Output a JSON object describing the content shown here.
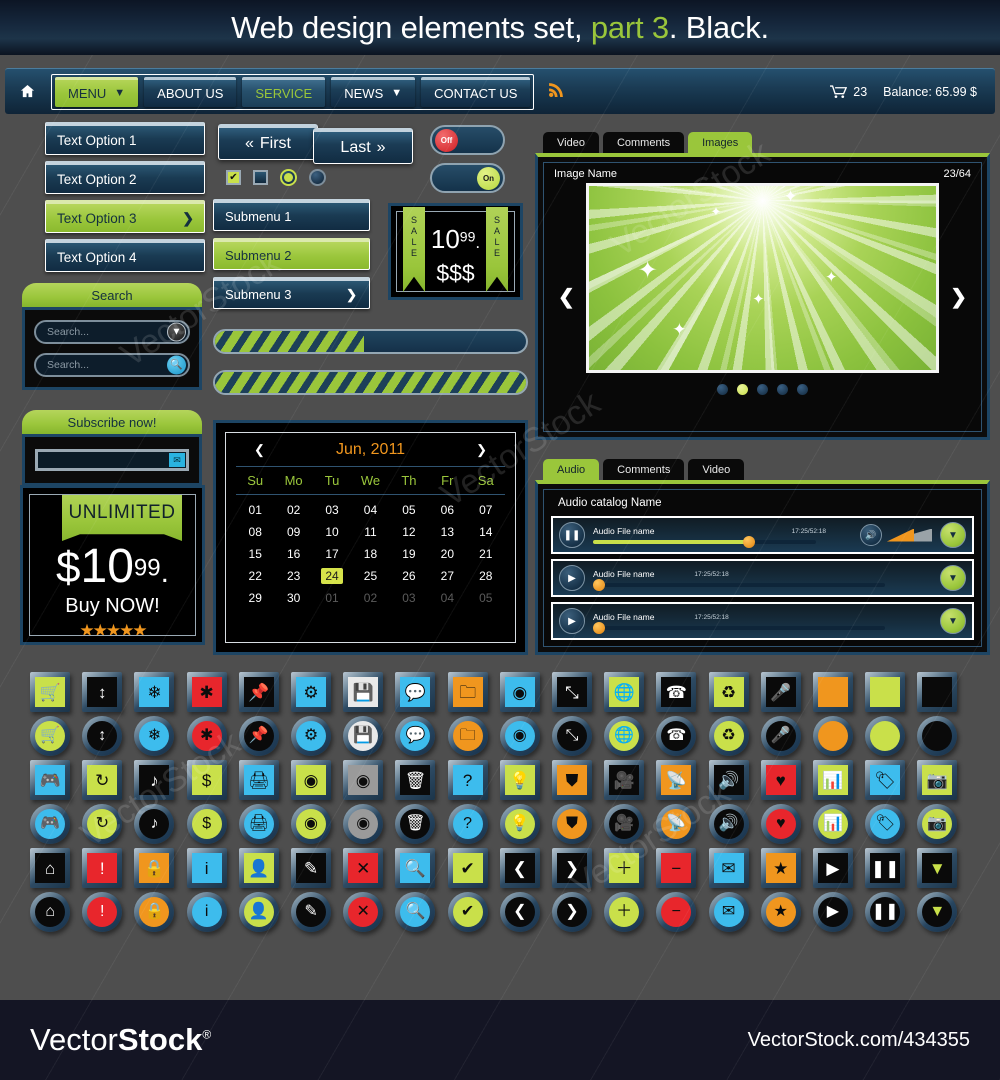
{
  "banner": {
    "title_part1": "Web design elements set, ",
    "title_green": "part 3",
    "title_part2": ". Black."
  },
  "nav": {
    "home_icon": "home-icon",
    "items": [
      {
        "label": "MENU",
        "style": "green",
        "caret": "▼"
      },
      {
        "label": "ABOUT US",
        "style": "dark",
        "caret": ""
      },
      {
        "label": "SERVICE",
        "style": "service",
        "caret": ""
      },
      {
        "label": "NEWS",
        "style": "dark",
        "caret": "▼"
      },
      {
        "label": "CONTACT US",
        "style": "dark",
        "caret": ""
      }
    ],
    "rss_icon": "rss-icon",
    "cart_icon": "cart-icon",
    "cart_count": "23",
    "balance": "Balance: 65.99 $"
  },
  "text_options": [
    {
      "label": "Text Option 1",
      "style": "dark"
    },
    {
      "label": "Text Option 2",
      "style": "dark"
    },
    {
      "label": "Text Option 3",
      "style": "green",
      "arrow": "❯"
    },
    {
      "label": "Text Option 4",
      "style": "dark"
    }
  ],
  "search_widget": {
    "title": "Search",
    "field1_placeholder": "Search...",
    "field1_icon": "chevron-down-icon",
    "field2_placeholder": "Search...",
    "field2_icon": "search-icon"
  },
  "subscribe_widget": {
    "title": "Subscribe now!",
    "value": "",
    "icon": "envelope-icon"
  },
  "price_box": {
    "ribbon": "UNLIMITED",
    "currency": "$",
    "amount": "10",
    "cents": "99",
    "dot": ".",
    "cta": "Buy NOW!",
    "stars": 5,
    "star_color": "#f0961e"
  },
  "pager": {
    "first_label": "First",
    "first_icon": "«",
    "last_label": "Last",
    "last_icon": "»"
  },
  "checkboxes": [
    {
      "name": "checkbox-checked",
      "checked": true,
      "shape": "square"
    },
    {
      "name": "checkbox-unchecked",
      "checked": false,
      "shape": "square"
    },
    {
      "name": "radio-checked",
      "checked": true,
      "shape": "circle"
    },
    {
      "name": "radio-unchecked",
      "checked": false,
      "shape": "circle"
    }
  ],
  "toggles": [
    {
      "label": "Off",
      "state": "off",
      "color": "#e0262a"
    },
    {
      "label": "On",
      "state": "on",
      "color": "#c9e04a"
    }
  ],
  "submenus": [
    {
      "label": "Submenu 1",
      "style": "dark"
    },
    {
      "label": "Submenu 2",
      "style": "green"
    },
    {
      "label": "Submenu 3",
      "style": "dark",
      "arrow": "❯"
    }
  ],
  "sale_tag": {
    "left_ribbon": "SALE",
    "right_ribbon": "SALE",
    "amount": "10",
    "cents": "99",
    "dot": ".",
    "dollars": "$$$"
  },
  "progress_bars": [
    {
      "name": "progress-bar-partial",
      "percent": 48
    },
    {
      "name": "progress-bar-full",
      "percent": 100
    }
  ],
  "calendar": {
    "prev_icon": "❮",
    "next_icon": "❯",
    "month_label": "Jun, 2011",
    "dow": [
      "Su",
      "Mo",
      "Tu",
      "We",
      "Th",
      "Fr",
      "Sa"
    ],
    "weeks": [
      [
        {
          "d": "01"
        },
        {
          "d": "02"
        },
        {
          "d": "03"
        },
        {
          "d": "04"
        },
        {
          "d": "05"
        },
        {
          "d": "06"
        },
        {
          "d": "07"
        }
      ],
      [
        {
          "d": "08"
        },
        {
          "d": "09"
        },
        {
          "d": "10"
        },
        {
          "d": "11"
        },
        {
          "d": "12"
        },
        {
          "d": "13"
        },
        {
          "d": "14"
        }
      ],
      [
        {
          "d": "15"
        },
        {
          "d": "16"
        },
        {
          "d": "17"
        },
        {
          "d": "18"
        },
        {
          "d": "19"
        },
        {
          "d": "20"
        },
        {
          "d": "21"
        }
      ],
      [
        {
          "d": "22"
        },
        {
          "d": "23"
        },
        {
          "d": "24",
          "sel": true
        },
        {
          "d": "25"
        },
        {
          "d": "26"
        },
        {
          "d": "27"
        },
        {
          "d": "28"
        }
      ],
      [
        {
          "d": "29"
        },
        {
          "d": "30"
        },
        {
          "d": "01",
          "mut": true
        },
        {
          "d": "02",
          "mut": true
        },
        {
          "d": "03",
          "mut": true
        },
        {
          "d": "04",
          "mut": true
        },
        {
          "d": "05",
          "mut": true
        }
      ]
    ],
    "selected_day": "24"
  },
  "gallery": {
    "tabs": [
      {
        "label": "Video",
        "active": false
      },
      {
        "label": "Comments",
        "active": false
      },
      {
        "label": "Images",
        "active": true
      }
    ],
    "image_name": "Image Name",
    "counter": "23/64",
    "prev_icon": "❮",
    "next_icon": "❯",
    "dots": 5,
    "active_dot": 2
  },
  "audio": {
    "tabs": [
      {
        "label": "Audio",
        "active": true
      },
      {
        "label": "Comments",
        "active": false
      },
      {
        "label": "Video",
        "active": false
      }
    ],
    "catalog_title": "Audio catalog Name",
    "rows": [
      {
        "play_icon": "pause-icon",
        "name": "Audio File name",
        "time": "17:25/52:18",
        "progress": 70,
        "volume_icon": "speaker-icon",
        "volume": 60,
        "expand_icon": "chevron-down-icon",
        "expand_state": "active"
      },
      {
        "play_icon": "play-icon",
        "name": "Audio File name",
        "time": "17:25/52:18",
        "progress": 3,
        "volume_icon": "",
        "volume": 0,
        "expand_icon": "chevron-down-icon",
        "expand_state": "active"
      },
      {
        "play_icon": "play-icon",
        "name": "Audio File name",
        "time": "17:25/52:18",
        "progress": 3,
        "volume_icon": "",
        "volume": 0,
        "expand_icon": "chevron-down-icon",
        "expand_state": "active"
      }
    ]
  },
  "icon_grid": {
    "rows": [
      [
        {
          "name": "cart-icon",
          "glyph": "🛒",
          "bg": "#c9e04a",
          "fg": "#111111"
        },
        {
          "name": "sliders-icon",
          "glyph": "↕",
          "bg": "#0a0a0a",
          "fg": "#ffffff"
        },
        {
          "name": "snowflake-icon",
          "glyph": "❄",
          "bg": "#3dbced",
          "fg": "#0d0d0d"
        },
        {
          "name": "asterisk-icon",
          "glyph": "✱",
          "bg": "#e8262c",
          "fg": "#0d0d0d"
        },
        {
          "name": "pin-icon",
          "glyph": "📌",
          "bg": "#0a0a0a",
          "fg": "#ffffff"
        },
        {
          "name": "gear-icon",
          "glyph": "⚙",
          "bg": "#3dbced",
          "fg": "#0d0d0d"
        },
        {
          "name": "save-icon",
          "glyph": "💾",
          "bg": "#e9e9e9",
          "fg": "#111111"
        },
        {
          "name": "chat-icon",
          "glyph": "💬",
          "bg": "#3dbced",
          "fg": "#0d0d0d"
        },
        {
          "name": "folder-icon",
          "glyph": "🗀",
          "bg": "#f0961e",
          "fg": "#0d0d0d"
        },
        {
          "name": "disc-icon",
          "glyph": "◉",
          "bg": "#3dbced",
          "fg": "#0d0d0d"
        },
        {
          "name": "expand-icon",
          "glyph": "⤡",
          "bg": "#0a0a0a",
          "fg": "#ffffff"
        },
        {
          "name": "globe-icon",
          "glyph": "🌐",
          "bg": "#c9e04a",
          "fg": "#0d0d0d"
        },
        {
          "name": "phone-icon",
          "glyph": "☎",
          "bg": "#0a0a0a",
          "fg": "#ffffff"
        },
        {
          "name": "recycle-icon",
          "glyph": "♻",
          "bg": "#c9e04a",
          "fg": "#0d0d0d"
        },
        {
          "name": "microphone-icon",
          "glyph": "🎤",
          "bg": "#0a0a0a",
          "fg": "#ffffff"
        },
        {
          "name": "blank-orange-icon",
          "glyph": "",
          "bg": "#f0961e",
          "fg": "#0d0d0d"
        },
        {
          "name": "blank-green-icon",
          "glyph": "",
          "bg": "#c9e04a",
          "fg": "#0d0d0d"
        },
        {
          "name": "blank-black-icon",
          "glyph": "",
          "bg": "#0a0a0a",
          "fg": "#ffffff"
        }
      ],
      [
        {
          "name": "game-controller-icon",
          "glyph": "🎮",
          "bg": "#3dbced",
          "fg": "#0d0d0d"
        },
        {
          "name": "refresh-icon",
          "glyph": "↻",
          "bg": "#c9e04a",
          "fg": "#0d0d0d"
        },
        {
          "name": "music-note-icon",
          "glyph": "♪",
          "bg": "#0a0a0a",
          "fg": "#ffffff"
        },
        {
          "name": "dollar-icon",
          "glyph": "$",
          "bg": "#c9e04a",
          "fg": "#0d0d0d"
        },
        {
          "name": "printer-icon",
          "glyph": "🖨",
          "bg": "#3dbced",
          "fg": "#0d0d0d"
        },
        {
          "name": "eye-icon",
          "glyph": "◉",
          "bg": "#c9e04a",
          "fg": "#0d0d0d"
        },
        {
          "name": "eye-gray-icon",
          "glyph": "◉",
          "bg": "#9a9a9a",
          "fg": "#0d0d0d"
        },
        {
          "name": "trash-icon",
          "glyph": "🗑",
          "bg": "#0a0a0a",
          "fg": "#ffffff"
        },
        {
          "name": "help-icon",
          "glyph": "?",
          "bg": "#3dbced",
          "fg": "#0d0d0d"
        },
        {
          "name": "lightbulb-icon",
          "glyph": "💡",
          "bg": "#c9e04a",
          "fg": "#0d0d0d"
        },
        {
          "name": "shield-icon",
          "glyph": "⛊",
          "bg": "#f0961e",
          "fg": "#0d0d0d"
        },
        {
          "name": "video-camera-icon",
          "glyph": "🎥",
          "bg": "#0a0a0a",
          "fg": "#ffffff"
        },
        {
          "name": "rss-icon",
          "glyph": "📡",
          "bg": "#f0961e",
          "fg": "#0d0d0d"
        },
        {
          "name": "speaker-icon",
          "glyph": "🔊",
          "bg": "#0a0a0a",
          "fg": "#ffffff"
        },
        {
          "name": "heart-icon",
          "glyph": "♥",
          "bg": "#e8262c",
          "fg": "#0d0d0d"
        },
        {
          "name": "chart-icon",
          "glyph": "📊",
          "bg": "#c9e04a",
          "fg": "#0d0d0d"
        },
        {
          "name": "tag-icon",
          "glyph": "🏷",
          "bg": "#3dbced",
          "fg": "#0d0d0d"
        },
        {
          "name": "camera-icon",
          "glyph": "📷",
          "bg": "#c9e04a",
          "fg": "#0d0d0d"
        }
      ],
      [
        {
          "name": "home-icon",
          "glyph": "⌂",
          "bg": "#0a0a0a",
          "fg": "#ffffff"
        },
        {
          "name": "warning-icon",
          "glyph": "!",
          "bg": "#e8262c",
          "fg": "#ffffff"
        },
        {
          "name": "lock-icon",
          "glyph": "🔒",
          "bg": "#f0961e",
          "fg": "#0d0d0d"
        },
        {
          "name": "info-icon",
          "glyph": "i",
          "bg": "#3dbced",
          "fg": "#0d0d0d"
        },
        {
          "name": "user-icon",
          "glyph": "👤",
          "bg": "#c9e04a",
          "fg": "#0d0d0d"
        },
        {
          "name": "pencil-icon",
          "glyph": "✎",
          "bg": "#0a0a0a",
          "fg": "#ffffff"
        },
        {
          "name": "close-icon",
          "glyph": "✕",
          "bg": "#e8262c",
          "fg": "#0d0d0d"
        },
        {
          "name": "search-icon",
          "glyph": "🔍",
          "bg": "#3dbced",
          "fg": "#0d0d0d"
        },
        {
          "name": "check-icon",
          "glyph": "✔",
          "bg": "#c9e04a",
          "fg": "#0d0d0d"
        },
        {
          "name": "chevron-left-icon",
          "glyph": "❮",
          "bg": "#0a0a0a",
          "fg": "#ffffff"
        },
        {
          "name": "chevron-right-icon",
          "glyph": "❯",
          "bg": "#0a0a0a",
          "fg": "#ffffff"
        },
        {
          "name": "plus-icon",
          "glyph": "＋",
          "bg": "#c9e04a",
          "fg": "#0d0d0d"
        },
        {
          "name": "minus-icon",
          "glyph": "−",
          "bg": "#e8262c",
          "fg": "#0d0d0d"
        },
        {
          "name": "envelope-icon",
          "glyph": "✉",
          "bg": "#3dbced",
          "fg": "#0d0d0d"
        },
        {
          "name": "star-icon",
          "glyph": "★",
          "bg": "#f0961e",
          "fg": "#0d0d0d"
        },
        {
          "name": "play-icon",
          "glyph": "▶",
          "bg": "#0a0a0a",
          "fg": "#ffffff"
        },
        {
          "name": "pause-icon",
          "glyph": "❚❚",
          "bg": "#0a0a0a",
          "fg": "#ffffff"
        },
        {
          "name": "chevron-down-circle-icon",
          "glyph": "▼",
          "bg": "#0a0a0a",
          "fg": "#c9e04a"
        }
      ]
    ]
  },
  "footer": {
    "logo_prefix": "Vector",
    "logo_suffix": "Stock",
    "logo_reg": "®",
    "url": "VectorStock.com/434355"
  },
  "watermarks": [
    "VectorStock",
    "VectorStock",
    "VectorStock",
    "VectorStock",
    "VectorStock"
  ],
  "colors": {
    "green": "#9ac63b",
    "blue": "#1d4564",
    "orange": "#f0961e",
    "red": "#e8262c",
    "cyan": "#3dbced",
    "dark": "#0a0a0a",
    "page_bg": "#4e4e4e"
  }
}
